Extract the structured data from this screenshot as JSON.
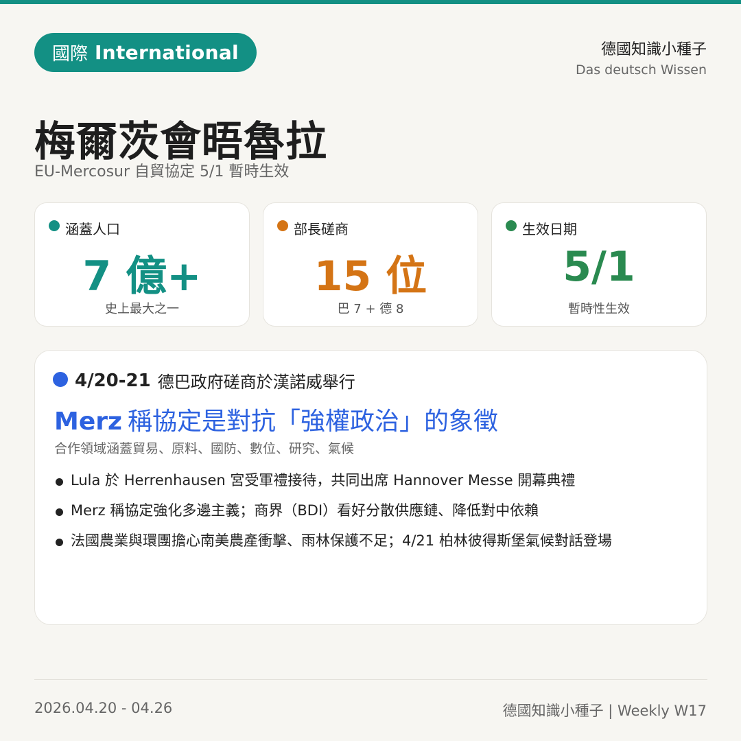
{
  "badge": {
    "zh": "國際",
    "en": "International"
  },
  "brand": {
    "zh": "德國知識小種子",
    "en": "Das deutsch Wissen"
  },
  "title": "梅爾茨會晤魯拉",
  "subtitle": "EU-Mercosur 自貿協定 5/1 暫時生效",
  "stats": [
    {
      "label": "涵蓋人口",
      "value": "7 億+",
      "note": "史上最大之一",
      "color": "#139084"
    },
    {
      "label": "部長磋商",
      "value": "15 位",
      "note": "巴 7 + 德 8",
      "color": "#d47415"
    },
    {
      "label": "生效日期",
      "value": "5/1",
      "note": "暫時性生效",
      "color": "#2a8a50"
    }
  ],
  "news": {
    "date": "4/20-21",
    "event": "德巴政府磋商於漢諾威舉行",
    "headline_who": "Merz",
    "headline_text": "稱協定是對抗「強權政治」的象徵",
    "fields": "合作領域涵蓋貿易、原料、國防、數位、研究、氣候",
    "bullets": [
      "Lula 於 Herrenhausen 宮受軍禮接待，共同出席 Hannover Messe 開幕典禮",
      "Merz 稱協定強化多邊主義；商界（BDI）看好分散供應鏈、降低對中依賴",
      "法國農業與環團擔心南美農產衝擊、雨林保護不足；4/21 柏林彼得斯堡氣候對話登場"
    ],
    "accent": "#2d62e0"
  },
  "footer": {
    "dates": "2026.04.20 - 04.26",
    "issue": "德國知識小種子 | Weekly W17"
  }
}
